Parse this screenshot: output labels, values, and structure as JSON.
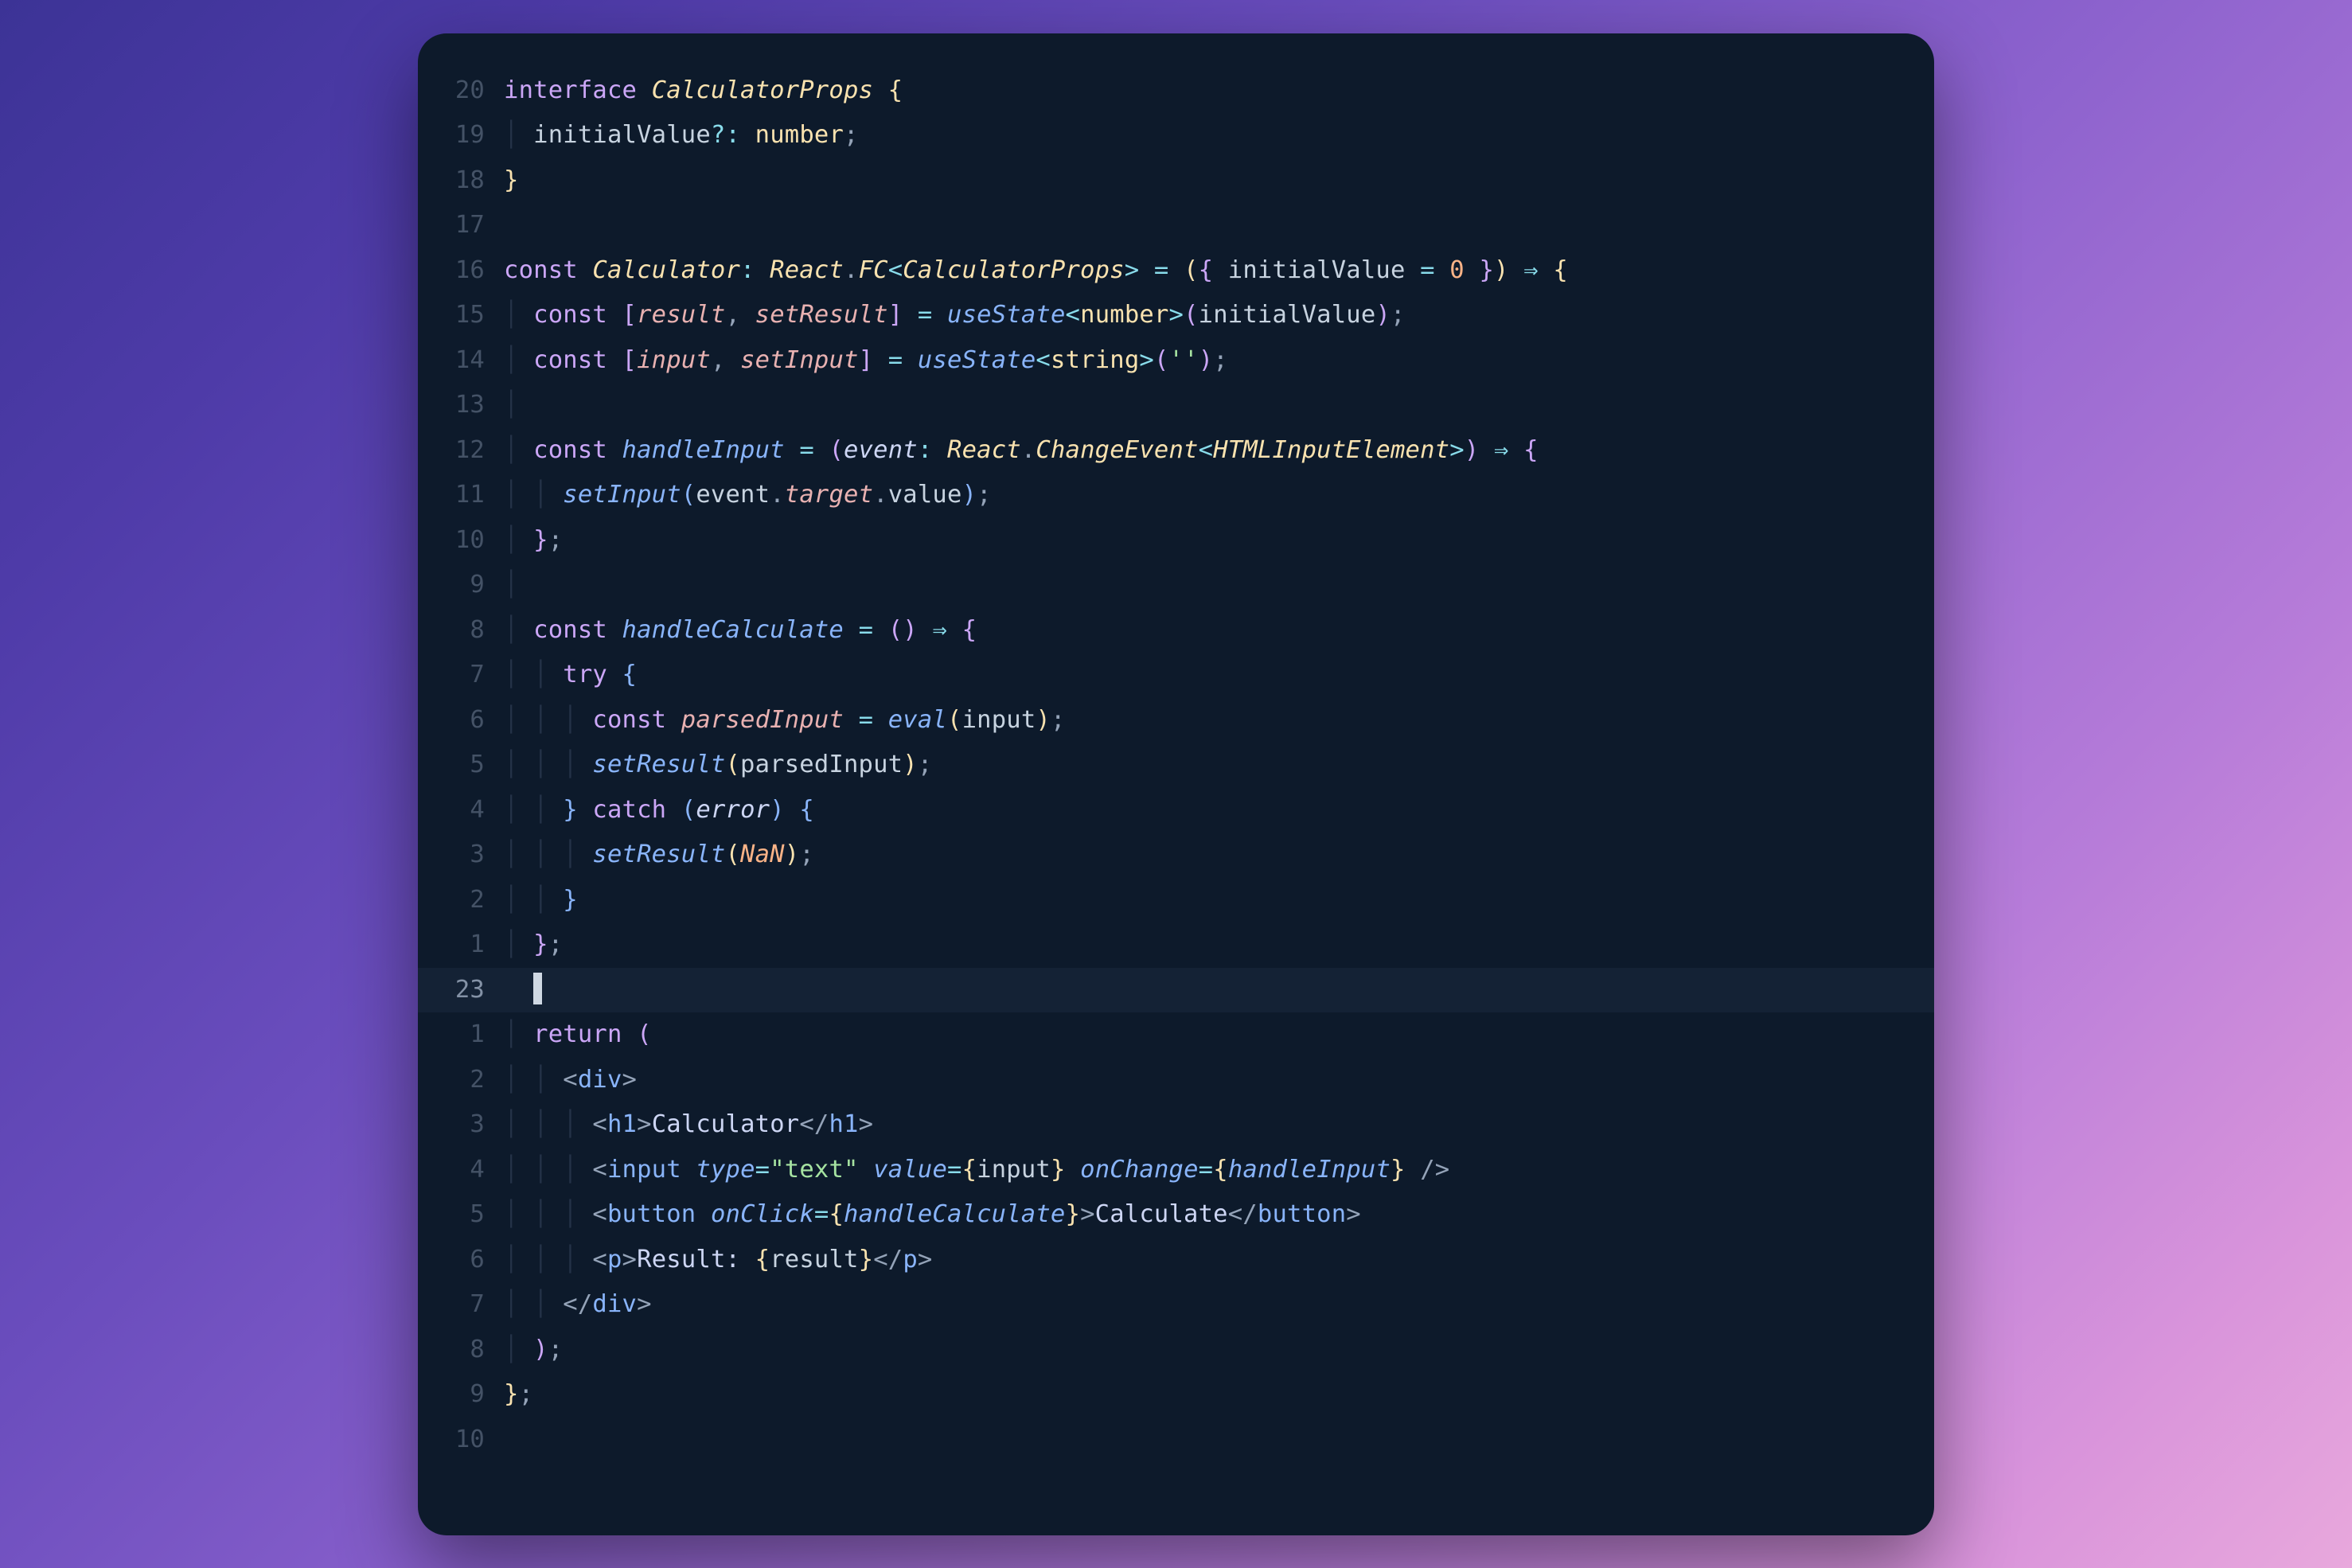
{
  "editor": {
    "gutter": [
      "20",
      "19",
      "18",
      "17",
      "16",
      "15",
      "14",
      "13",
      "12",
      "11",
      "10",
      "9",
      "8",
      "7",
      "6",
      "5",
      "4",
      "3",
      "2",
      "1",
      "23",
      "1",
      "2",
      "3",
      "4",
      "5",
      "6",
      "7",
      "8",
      "9",
      "10"
    ],
    "current_line_index": 20,
    "lines": {
      "l0": {
        "t": [
          [
            "kw",
            "interface "
          ],
          [
            "typ",
            "CalculatorProps"
          ],
          [
            "txt",
            " "
          ],
          [
            "par",
            "{"
          ]
        ]
      },
      "l1": {
        "i": 1,
        "t": [
          [
            "prop",
            "initialValue"
          ],
          [
            "op",
            "?"
          ],
          [
            "op",
            ": "
          ],
          [
            "typ2",
            "number"
          ],
          [
            "punc",
            ";"
          ]
        ]
      },
      "l2": {
        "t": [
          [
            "par",
            "}"
          ]
        ]
      },
      "l3": {
        "t": []
      },
      "l4": {
        "t": [
          [
            "kw",
            "const "
          ],
          [
            "typ",
            "Calculator"
          ],
          [
            "op",
            ": "
          ],
          [
            "typ",
            "React"
          ],
          [
            "punc",
            "."
          ],
          [
            "typ",
            "FC"
          ],
          [
            "op",
            "<"
          ],
          [
            "typ",
            "CalculatorProps"
          ],
          [
            "op",
            ">"
          ],
          [
            "txt",
            " "
          ],
          [
            "op",
            "="
          ],
          [
            "txt",
            " "
          ],
          [
            "par",
            "("
          ],
          [
            "par2",
            "{"
          ],
          [
            "txt",
            " "
          ],
          [
            "prop",
            "initialValue"
          ],
          [
            "txt",
            " "
          ],
          [
            "op",
            "="
          ],
          [
            "txt",
            " "
          ],
          [
            "num",
            "0"
          ],
          [
            "txt",
            " "
          ],
          [
            "par2",
            "}"
          ],
          [
            "par",
            ")"
          ],
          [
            "txt",
            " "
          ],
          [
            "op",
            "⇒"
          ],
          [
            "txt",
            " "
          ],
          [
            "par",
            "{"
          ]
        ]
      },
      "l5": {
        "i": 1,
        "t": [
          [
            "kw",
            "const "
          ],
          [
            "par2",
            "["
          ],
          [
            "var",
            "result"
          ],
          [
            "punc",
            ", "
          ],
          [
            "var",
            "setResult"
          ],
          [
            "par2",
            "]"
          ],
          [
            "txt",
            " "
          ],
          [
            "op",
            "="
          ],
          [
            "txt",
            " "
          ],
          [
            "fn",
            "useState"
          ],
          [
            "op",
            "<"
          ],
          [
            "typ2",
            "number"
          ],
          [
            "op",
            ">"
          ],
          [
            "par2",
            "("
          ],
          [
            "prop",
            "initialValue"
          ],
          [
            "par2",
            ")"
          ],
          [
            "punc",
            ";"
          ]
        ]
      },
      "l6": {
        "i": 1,
        "t": [
          [
            "kw",
            "const "
          ],
          [
            "par2",
            "["
          ],
          [
            "var",
            "input"
          ],
          [
            "punc",
            ", "
          ],
          [
            "var",
            "setInput"
          ],
          [
            "par2",
            "]"
          ],
          [
            "txt",
            " "
          ],
          [
            "op",
            "="
          ],
          [
            "txt",
            " "
          ],
          [
            "fn",
            "useState"
          ],
          [
            "op",
            "<"
          ],
          [
            "typ2",
            "string"
          ],
          [
            "op",
            ">"
          ],
          [
            "par2",
            "("
          ],
          [
            "str",
            "''"
          ],
          [
            "par2",
            ")"
          ],
          [
            "punc",
            ";"
          ]
        ]
      },
      "l7": {
        "i": 1,
        "t": []
      },
      "l8": {
        "i": 1,
        "t": [
          [
            "kw",
            "const "
          ],
          [
            "fn",
            "handleInput"
          ],
          [
            "txt",
            " "
          ],
          [
            "op",
            "="
          ],
          [
            "txt",
            " "
          ],
          [
            "par2",
            "("
          ],
          [
            "var2",
            "event"
          ],
          [
            "op",
            ": "
          ],
          [
            "typ",
            "React"
          ],
          [
            "punc",
            "."
          ],
          [
            "typ",
            "ChangeEvent"
          ],
          [
            "op",
            "<"
          ],
          [
            "typ",
            "HTMLInputElement"
          ],
          [
            "op",
            ">"
          ],
          [
            "par2",
            ")"
          ],
          [
            "txt",
            " "
          ],
          [
            "op",
            "⇒"
          ],
          [
            "txt",
            " "
          ],
          [
            "par2",
            "{"
          ]
        ]
      },
      "l9": {
        "i": 2,
        "t": [
          [
            "fn",
            "setInput"
          ],
          [
            "par3",
            "("
          ],
          [
            "prop",
            "event"
          ],
          [
            "punc",
            "."
          ],
          [
            "var",
            "target"
          ],
          [
            "punc",
            "."
          ],
          [
            "prop",
            "value"
          ],
          [
            "par3",
            ")"
          ],
          [
            "punc",
            ";"
          ]
        ]
      },
      "l10": {
        "i": 1,
        "t": [
          [
            "par2",
            "}"
          ],
          [
            "punc",
            ";"
          ]
        ]
      },
      "l11": {
        "i": 1,
        "t": []
      },
      "l12": {
        "i": 1,
        "t": [
          [
            "kw",
            "const "
          ],
          [
            "fn",
            "handleCalculate"
          ],
          [
            "txt",
            " "
          ],
          [
            "op",
            "="
          ],
          [
            "txt",
            " "
          ],
          [
            "par2",
            "("
          ],
          [
            "par2",
            ")"
          ],
          [
            "txt",
            " "
          ],
          [
            "op",
            "⇒"
          ],
          [
            "txt",
            " "
          ],
          [
            "par2",
            "{"
          ]
        ]
      },
      "l13": {
        "i": 2,
        "t": [
          [
            "kw",
            "try"
          ],
          [
            "txt",
            " "
          ],
          [
            "par3",
            "{"
          ]
        ]
      },
      "l14": {
        "i": 3,
        "t": [
          [
            "kw",
            "const "
          ],
          [
            "var",
            "parsedInput"
          ],
          [
            "txt",
            " "
          ],
          [
            "op",
            "="
          ],
          [
            "txt",
            " "
          ],
          [
            "fn",
            "eval"
          ],
          [
            "par",
            "("
          ],
          [
            "prop",
            "input"
          ],
          [
            "par",
            ")"
          ],
          [
            "punc",
            ";"
          ]
        ]
      },
      "l15": {
        "i": 3,
        "t": [
          [
            "fn",
            "setResult"
          ],
          [
            "par",
            "("
          ],
          [
            "prop",
            "parsedInput"
          ],
          [
            "par",
            ")"
          ],
          [
            "punc",
            ";"
          ]
        ]
      },
      "l16": {
        "i": 2,
        "t": [
          [
            "par3",
            "}"
          ],
          [
            "txt",
            " "
          ],
          [
            "kw",
            "catch"
          ],
          [
            "txt",
            " "
          ],
          [
            "par3",
            "("
          ],
          [
            "var2",
            "error"
          ],
          [
            "par3",
            ")"
          ],
          [
            "txt",
            " "
          ],
          [
            "par3",
            "{"
          ]
        ]
      },
      "l17": {
        "i": 3,
        "t": [
          [
            "fn",
            "setResult"
          ],
          [
            "par",
            "("
          ],
          [
            "cnst",
            "NaN"
          ],
          [
            "par",
            ")"
          ],
          [
            "punc",
            ";"
          ]
        ]
      },
      "l18": {
        "i": 2,
        "t": [
          [
            "par3",
            "}"
          ]
        ]
      },
      "l19": {
        "i": 1,
        "t": [
          [
            "par2",
            "}"
          ],
          [
            "punc",
            ";"
          ]
        ]
      },
      "l20": {
        "i": 0,
        "cursor": true,
        "t": []
      },
      "l21": {
        "i": 1,
        "t": [
          [
            "kw",
            "return"
          ],
          [
            "txt",
            " "
          ],
          [
            "par2",
            "("
          ]
        ]
      },
      "l22": {
        "i": 2,
        "t": [
          [
            "punc",
            "<"
          ],
          [
            "tag",
            "div"
          ],
          [
            "punc",
            ">"
          ]
        ]
      },
      "l23": {
        "i": 3,
        "t": [
          [
            "punc",
            "<"
          ],
          [
            "tag",
            "h1"
          ],
          [
            "punc",
            ">"
          ],
          [
            "txt",
            "Calculator"
          ],
          [
            "punc",
            "</"
          ],
          [
            "tag",
            "h1"
          ],
          [
            "punc",
            ">"
          ]
        ]
      },
      "l24": {
        "i": 3,
        "t": [
          [
            "punc",
            "<"
          ],
          [
            "tag",
            "input"
          ],
          [
            "txt",
            " "
          ],
          [
            "attr",
            "type"
          ],
          [
            "op",
            "="
          ],
          [
            "str",
            "\"text\""
          ],
          [
            "txt",
            " "
          ],
          [
            "attr",
            "value"
          ],
          [
            "op",
            "="
          ],
          [
            "par",
            "{"
          ],
          [
            "prop",
            "input"
          ],
          [
            "par",
            "}"
          ],
          [
            "txt",
            " "
          ],
          [
            "attr",
            "onChange"
          ],
          [
            "op",
            "="
          ],
          [
            "par",
            "{"
          ],
          [
            "fn",
            "handleInput"
          ],
          [
            "par",
            "}"
          ],
          [
            "txt",
            " "
          ],
          [
            "punc",
            "/>"
          ]
        ]
      },
      "l25": {
        "i": 3,
        "t": [
          [
            "punc",
            "<"
          ],
          [
            "tag",
            "button"
          ],
          [
            "txt",
            " "
          ],
          [
            "attr",
            "onClick"
          ],
          [
            "op",
            "="
          ],
          [
            "par",
            "{"
          ],
          [
            "fn",
            "handleCalculate"
          ],
          [
            "par",
            "}"
          ],
          [
            "punc",
            ">"
          ],
          [
            "txt",
            "Calculate"
          ],
          [
            "punc",
            "</"
          ],
          [
            "tag",
            "button"
          ],
          [
            "punc",
            ">"
          ]
        ]
      },
      "l26": {
        "i": 3,
        "t": [
          [
            "punc",
            "<"
          ],
          [
            "tag",
            "p"
          ],
          [
            "punc",
            ">"
          ],
          [
            "txt",
            "Result: "
          ],
          [
            "par",
            "{"
          ],
          [
            "prop",
            "result"
          ],
          [
            "par",
            "}"
          ],
          [
            "punc",
            "</"
          ],
          [
            "tag",
            "p"
          ],
          [
            "punc",
            ">"
          ]
        ]
      },
      "l27": {
        "i": 2,
        "t": [
          [
            "punc",
            "</"
          ],
          [
            "tag",
            "div"
          ],
          [
            "punc",
            ">"
          ]
        ]
      },
      "l28": {
        "i": 1,
        "t": [
          [
            "par2",
            ")"
          ],
          [
            "punc",
            ";"
          ]
        ]
      },
      "l29": {
        "t": [
          [
            "par",
            "}"
          ],
          [
            "punc",
            ";"
          ]
        ]
      },
      "l30": {
        "t": []
      }
    }
  }
}
